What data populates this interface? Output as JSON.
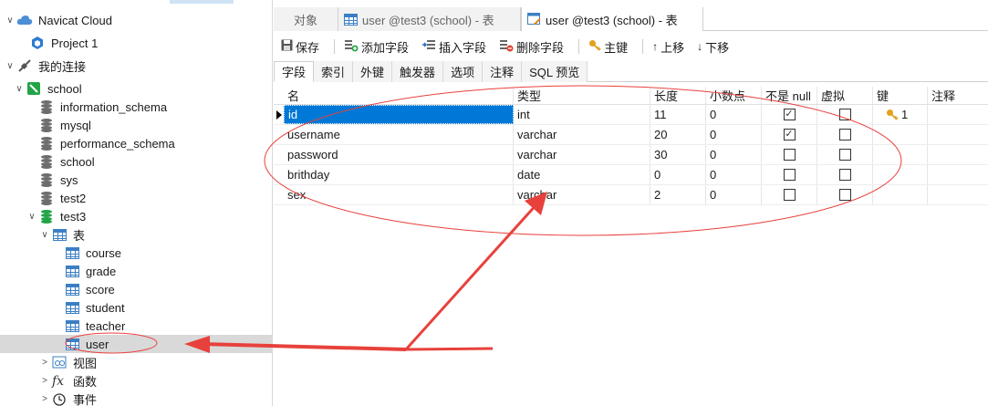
{
  "navigator": {
    "items": [
      {
        "label": "Navicat Cloud",
        "twisty": "∨",
        "icon": "cloud-icon"
      },
      {
        "label": "Project 1",
        "twisty": "",
        "icon": "project-icon"
      },
      {
        "label": "我的连接",
        "twisty": "∨",
        "icon": "connection-icon"
      },
      {
        "label": "school",
        "twisty": "∨",
        "icon": "mysql-connection-icon"
      },
      {
        "label": "information_schema",
        "twisty": "",
        "icon": "database-icon"
      },
      {
        "label": "mysql",
        "twisty": "",
        "icon": "database-icon"
      },
      {
        "label": "performance_schema",
        "twisty": "",
        "icon": "database-icon"
      },
      {
        "label": "school",
        "twisty": "",
        "icon": "database-icon"
      },
      {
        "label": "sys",
        "twisty": "",
        "icon": "database-icon"
      },
      {
        "label": "test2",
        "twisty": "",
        "icon": "database-icon"
      },
      {
        "label": "test3",
        "twisty": "∨",
        "icon": "database-open-icon"
      },
      {
        "label": "表",
        "twisty": "∨",
        "icon": "tables-folder-icon"
      },
      {
        "label": "course",
        "twisty": "",
        "icon": "table-icon"
      },
      {
        "label": "grade",
        "twisty": "",
        "icon": "table-icon"
      },
      {
        "label": "score",
        "twisty": "",
        "icon": "table-icon"
      },
      {
        "label": "student",
        "twisty": "",
        "icon": "table-icon"
      },
      {
        "label": "teacher",
        "twisty": "",
        "icon": "table-icon"
      },
      {
        "label": "user",
        "twisty": "",
        "icon": "table-icon"
      },
      {
        "label": "视图",
        "twisty": ">",
        "icon": "view-icon"
      },
      {
        "label": "函数",
        "twisty": ">",
        "icon": "function-icon"
      },
      {
        "label": "事件",
        "twisty": ">",
        "icon": "event-icon"
      }
    ]
  },
  "tabs": [
    {
      "label": "对象"
    },
    {
      "label": "user @test3 (school) - 表"
    },
    {
      "label": "user @test3 (school) - 表"
    }
  ],
  "toolbar": {
    "save": "保存",
    "add_field": "添加字段",
    "insert_field": "插入字段",
    "delete_field": "删除字段",
    "primary_key": "主键",
    "move_up": "上移",
    "move_down": "下移"
  },
  "subtabs": [
    "字段",
    "索引",
    "外键",
    "触发器",
    "选项",
    "注释",
    "SQL 预览"
  ],
  "grid": {
    "headers": [
      "名",
      "类型",
      "长度",
      "小数点",
      "不是 null",
      "虚拟",
      "键",
      "注释"
    ],
    "rows": [
      {
        "name": "id",
        "type": "int",
        "length": "11",
        "decimals": "0",
        "not_null": true,
        "virtual": false,
        "key": "1"
      },
      {
        "name": "username",
        "type": "varchar",
        "length": "20",
        "decimals": "0",
        "not_null": true,
        "virtual": false,
        "key": ""
      },
      {
        "name": "password",
        "type": "varchar",
        "length": "30",
        "decimals": "0",
        "not_null": false,
        "virtual": false,
        "key": ""
      },
      {
        "name": "brithday",
        "type": "date",
        "length": "0",
        "decimals": "0",
        "not_null": false,
        "virtual": false,
        "key": ""
      },
      {
        "name": "sex",
        "type": "varchar",
        "length": "2",
        "decimals": "0",
        "not_null": false,
        "virtual": false,
        "key": ""
      }
    ]
  },
  "colors": {
    "selection": "#0078d7",
    "annotation": "#e8413c",
    "db_open": "#22a447",
    "table_icon": "#3b7fc4"
  }
}
